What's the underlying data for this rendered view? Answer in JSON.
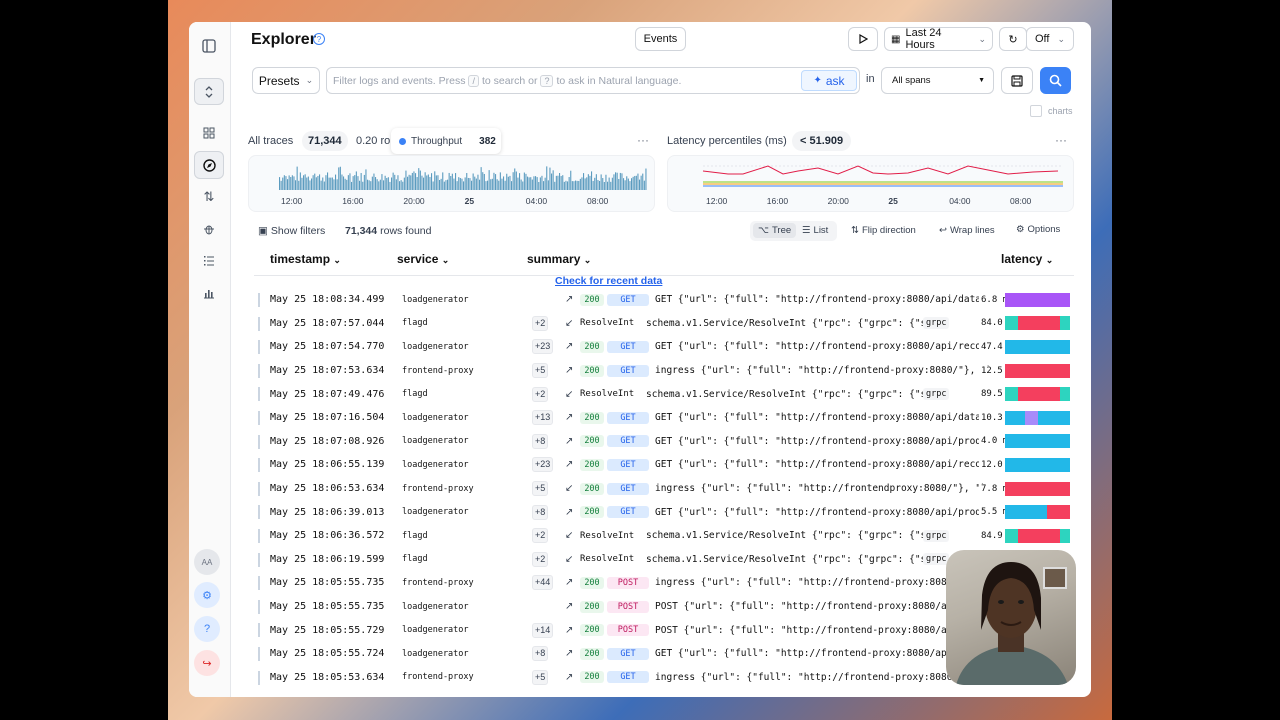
{
  "app": {
    "title": "Explorer"
  },
  "header": {
    "events_label": "Events",
    "time_range": "Last 24 Hours",
    "refresh": "Off"
  },
  "query": {
    "presets_label": "Presets",
    "search_prefix": "Filter logs and events. Press",
    "key_slash": "/",
    "search_mid": "to search or",
    "key_q": "?",
    "search_suffix": "to ask in Natural language.",
    "ask_label": "ask",
    "in_label": "in",
    "spans_value": "All spans",
    "charts_label": "charts"
  },
  "traces_panel": {
    "label": "All traces",
    "count": "71,344",
    "rate": "0.20 ro",
    "tooltip_label": "Throughput",
    "tooltip_value": "382",
    "ticks": [
      "12:00",
      "16:00",
      "20:00",
      "25",
      "04:00",
      "08:00"
    ]
  },
  "latency_panel": {
    "label": "Latency percentiles (ms)",
    "value": "< 51.909",
    "ticks": [
      "12:00",
      "16:00",
      "20:00",
      "25",
      "04:00",
      "08:00"
    ]
  },
  "toolbar": {
    "show_filters": "Show filters",
    "rows_count": "71,344",
    "rows_label": "rows found",
    "tree": "Tree",
    "list": "List",
    "flip": "Flip direction",
    "wrap": "Wrap lines",
    "options": "Options"
  },
  "columns": {
    "timestamp": "timestamp",
    "service": "service",
    "summary": "summary",
    "latency": "latency"
  },
  "recent_link": "Check for recent data",
  "rows": [
    {
      "ts": "May 25 18:08:34.499",
      "svc": "loadgenerator",
      "cnt": "",
      "arrow": "↗",
      "code": "200",
      "method": "GET",
      "summary": "GET {\"url\": {\"full\": \"http://frontend-proxy:8080/api/data/?contextKey",
      "lat": "6.8 ms"
    },
    {
      "ts": "May 25 18:07:57.044",
      "svc": "flagd",
      "cnt": "+2",
      "arrow": "↙",
      "code": "",
      "method": "ResolveInt",
      "summary": "schema.v1.Service/ResolveInt {\"rpc\": {\"grpc\": {\"status_c",
      "tag": "grpc",
      "lat": "84.0 µs"
    },
    {
      "ts": "May 25 18:07:54.770",
      "svc": "loadgenerator",
      "cnt": "+23",
      "arrow": "↗",
      "code": "200",
      "method": "GET",
      "summary": "GET {\"url\": {\"full\": \"http://frontend-proxy:8080/api/recommen",
      "lat": "47.4 ms"
    },
    {
      "ts": "May 25 18:07:53.634",
      "svc": "frontend-proxy",
      "cnt": "+5",
      "arrow": "↗",
      "code": "200",
      "method": "GET",
      "summary": "ingress {\"url\": {\"full\": \"http://frontend-proxy:8080/\"}, \"http\":",
      "lat": "12.5 ms"
    },
    {
      "ts": "May 25 18:07:49.476",
      "svc": "flagd",
      "cnt": "+2",
      "arrow": "↙",
      "code": "",
      "method": "ResolveInt",
      "summary": "schema.v1.Service/ResolveInt {\"rpc\": {\"grpc\": {\"status_c",
      "tag": "grpc",
      "lat": "89.5 µs"
    },
    {
      "ts": "May 25 18:07:16.504",
      "svc": "loadgenerator",
      "cnt": "+13",
      "arrow": "↗",
      "code": "200",
      "method": "GET",
      "summary": "GET {\"url\": {\"full\": \"http://frontend-proxy:8080/api/data/?conte",
      "lat": "10.3 ms"
    },
    {
      "ts": "May 25 18:07:08.926",
      "svc": "loadgenerator",
      "cnt": "+8",
      "arrow": "↗",
      "code": "200",
      "method": "GET",
      "summary": "GET {\"url\": {\"full\": \"http://frontend-proxy:8080/api/products/0F",
      "lat": "4.0 ms"
    },
    {
      "ts": "May 25 18:06:55.139",
      "svc": "loadgenerator",
      "cnt": "+23",
      "arrow": "↗",
      "code": "200",
      "method": "GET",
      "summary": "GET {\"url\": {\"full\": \"http://frontend-proxy:8080/api/recommen",
      "lat": "12.0 ms"
    },
    {
      "ts": "May 25 18:06:53.634",
      "svc": "frontend-proxy",
      "cnt": "+5",
      "arrow": "↙",
      "code": "200",
      "method": "GET",
      "summary": "ingress {\"url\": {\"full\": \"http://frontendproxy:8080/\"}, \"http\":",
      "lat": "7.8 ms"
    },
    {
      "ts": "May 25 18:06:39.013",
      "svc": "loadgenerator",
      "cnt": "+8",
      "arrow": "↗",
      "code": "200",
      "method": "GET",
      "summary": "GET {\"url\": {\"full\": \"http://frontend-proxy:8080/api/products/6E",
      "lat": "5.5 ms"
    },
    {
      "ts": "May 25 18:06:36.572",
      "svc": "flagd",
      "cnt": "+2",
      "arrow": "↙",
      "code": "",
      "method": "ResolveInt",
      "summary": "schema.v1.Service/ResolveInt {\"rpc\": {\"grpc\": {\"status_c",
      "tag": "grpc",
      "lat": "84.9 µs"
    },
    {
      "ts": "May 25 18:06:19.599",
      "svc": "flagd",
      "cnt": "+2",
      "arrow": "↙",
      "code": "",
      "method": "ResolveInt",
      "summary": "schema.v1.Service/ResolveInt {\"rpc\": {\"grpc\": {\"status_c",
      "tag": "grpc",
      "lat": ""
    },
    {
      "ts": "May 25 18:05:55.735",
      "svc": "frontend-proxy",
      "cnt": "+44",
      "arrow": "↗",
      "code": "200",
      "method": "POST",
      "summary": "ingress {\"url\": {\"full\": \"http://frontend-proxy:8080/api/chec",
      "lat": ""
    },
    {
      "ts": "May 25 18:05:55.735",
      "svc": "loadgenerator",
      "cnt": "",
      "arrow": "↗",
      "code": "200",
      "method": "POST",
      "summary": "POST {\"url\": {\"full\": \"http://frontend-proxy:8080/api/checkout\"},",
      "lat": ""
    },
    {
      "ts": "May 25 18:05:55.729",
      "svc": "loadgenerator",
      "cnt": "+14",
      "arrow": "↗",
      "code": "200",
      "method": "POST",
      "summary": "POST {\"url\": {\"full\": \"http://frontend-proxy:8080/api/cart\"},",
      "lat": ""
    },
    {
      "ts": "May 25 18:05:55.724",
      "svc": "loadgenerator",
      "cnt": "+8",
      "arrow": "↗",
      "code": "200",
      "method": "GET",
      "summary": "GET {\"url\": {\"full\": \"http://frontend-proxy:8080/api/products",
      "lat": ""
    },
    {
      "ts": "May 25 18:05:53.634",
      "svc": "frontend-proxy",
      "cnt": "+5",
      "arrow": "↗",
      "code": "200",
      "method": "GET",
      "summary": "ingress {\"url\": {\"full\": \"http://frontend-proxy:8080/\"}, \"http\":",
      "lat": ""
    }
  ],
  "sidebar": {
    "avatar_initials": "AA"
  },
  "colors": {
    "accent": "#3b82f6",
    "throughput": "#5b9bbf",
    "latency_line": "#e11d48"
  }
}
